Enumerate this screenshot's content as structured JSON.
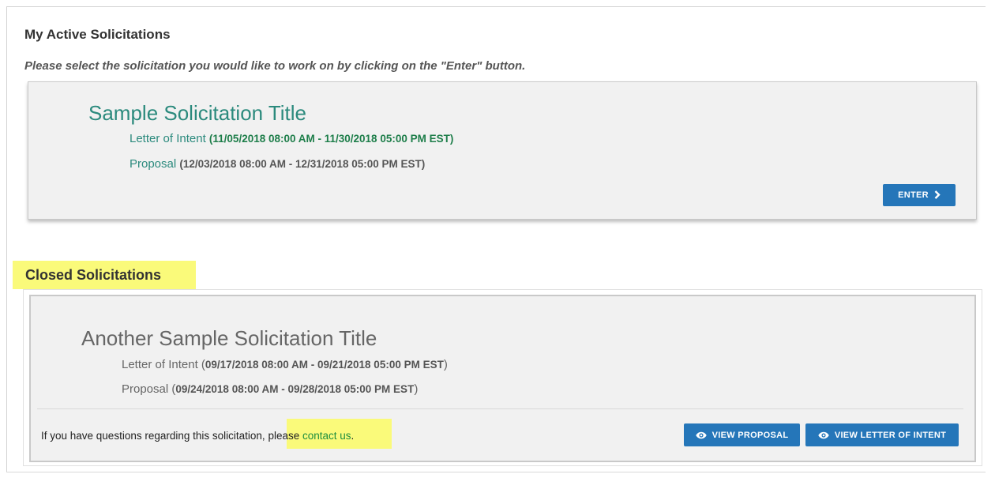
{
  "active": {
    "heading": "My Active Solicitations",
    "instructions": "Please select the solicitation you would like to work on by clicking on the \"Enter\" button.",
    "solicitation": {
      "title": "Sample Solicitation Title",
      "loi_label": "Letter of Intent",
      "loi_dates": "(11/05/2018 08:00 AM - 11/30/2018 05:00 PM EST)",
      "proposal_label": "Proposal",
      "proposal_dates": "(12/03/2018 08:00 AM - 12/31/2018 05:00 PM EST)",
      "enter_label": "ENTER"
    }
  },
  "closed": {
    "heading": "Closed Solicitations",
    "solicitation": {
      "title": "Another Sample Solicitation Title",
      "loi_label": "Letter of Intent",
      "loi_dates": "09/17/2018 08:00 AM - 09/21/2018 05:00 PM EST",
      "proposal_label": "Proposal",
      "proposal_dates": "09/24/2018 08:00 AM - 09/28/2018 05:00 PM EST",
      "question_prefix": "If you have questions regarding this solicitation,",
      "question_please": "please",
      "contact_link": "contact us",
      "view_proposal_label": "VIEW PROPOSAL",
      "view_loi_label": "VIEW LETTER OF INTENT"
    }
  },
  "colors": {
    "accent_teal": "#2b8a7d",
    "button_blue": "#2576b9",
    "highlight_yellow": "#fafa7a",
    "date_green": "#1e7e4a"
  },
  "icons": {
    "enter": "chevron-right-icon",
    "view": "eye-icon"
  }
}
